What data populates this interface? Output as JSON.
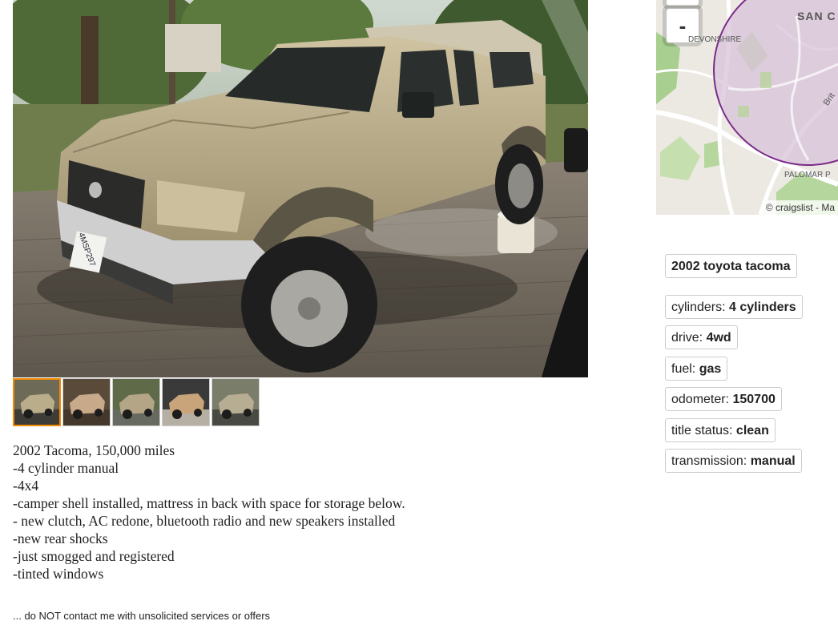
{
  "listing": {
    "thumbnails": [
      {
        "alt": "thumbnail 1",
        "selected": true
      },
      {
        "alt": "thumbnail 2",
        "selected": false
      },
      {
        "alt": "thumbnail 3",
        "selected": false
      },
      {
        "alt": "thumbnail 4",
        "selected": false
      },
      {
        "alt": "thumbnail 5",
        "selected": false
      }
    ],
    "plate_text": "4MSP297",
    "description": [
      "2002 Tacoma, 150,000 miles",
      "-4 cylinder manual",
      "-4x4",
      "-camper shell installed, mattress in back with space for storage below.",
      "- new clutch, AC redone, bluetooth radio and new speakers installed",
      "-new rear shocks",
      "-just smogged and registered",
      "-tinted windows"
    ],
    "description_cut": "... do NOT contact me with unsolicited services or offers"
  },
  "map": {
    "zoom_out_label": "-",
    "label_city": "SAN C",
    "label_devonshire": "DEVONSHIRE",
    "label_palomar": "PALOMAR P",
    "label_road": "Brit",
    "credit": "© craigslist - Ma"
  },
  "attributes": {
    "title": "2002 toyota tacoma",
    "items": [
      {
        "key": "cylinders: ",
        "value": "4 cylinders"
      },
      {
        "key": "drive: ",
        "value": "4wd"
      },
      {
        "key": "fuel: ",
        "value": "gas"
      },
      {
        "key": "odometer: ",
        "value": "150700"
      },
      {
        "key": "title status: ",
        "value": "clean"
      },
      {
        "key": "transmission: ",
        "value": "manual"
      }
    ]
  },
  "colors": {
    "accent_selected_thumb": "#f28b00",
    "map_circle": "#7b2a8a",
    "map_circle_fill": "#d9c6dc",
    "truck_body": "#b8ab88",
    "pavement": "#7d7466"
  }
}
